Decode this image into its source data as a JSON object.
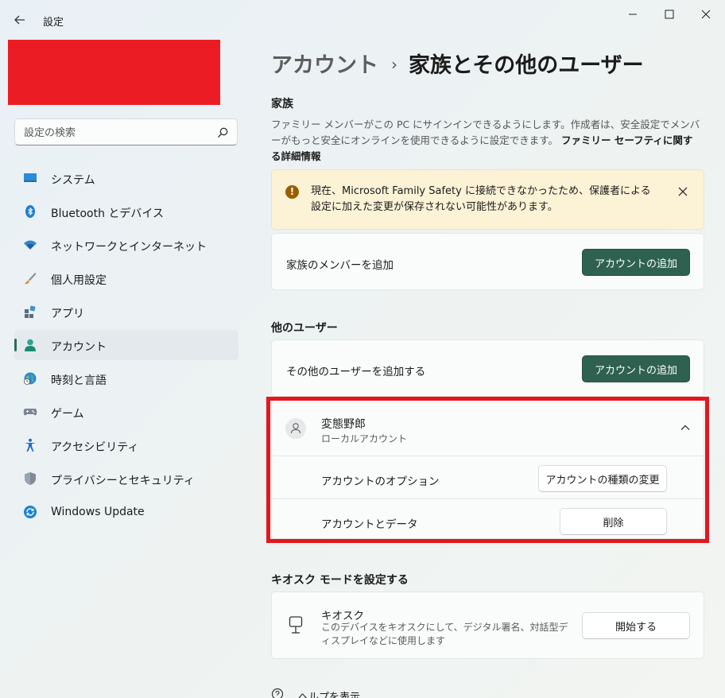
{
  "window": {
    "title": "設定"
  },
  "search": {
    "placeholder": "設定の検索"
  },
  "sidebar": {
    "items": [
      {
        "label": "システム",
        "icon": "system-icon"
      },
      {
        "label": "Bluetooth とデバイス",
        "icon": "bluetooth-icon"
      },
      {
        "label": "ネットワークとインターネット",
        "icon": "wifi-icon"
      },
      {
        "label": "個人用設定",
        "icon": "brush-icon"
      },
      {
        "label": "アプリ",
        "icon": "apps-icon"
      },
      {
        "label": "アカウント",
        "icon": "account-icon",
        "selected": true
      },
      {
        "label": "時刻と言語",
        "icon": "time-language-icon"
      },
      {
        "label": "ゲーム",
        "icon": "gamepad-icon"
      },
      {
        "label": "アクセシビリティ",
        "icon": "accessibility-icon"
      },
      {
        "label": "プライバシーとセキュリティ",
        "icon": "shield-icon"
      },
      {
        "label": "Windows Update",
        "icon": "update-icon"
      }
    ]
  },
  "breadcrumb": {
    "parent": "アカウント",
    "separator": "›",
    "current": "家族とその他のユーザー"
  },
  "family": {
    "heading": "家族",
    "description": "ファミリー メンバーがこの PC にサインインできるようにします。作成者は、安全設定でメンバーがもっと安全にオンラインを使用できるように設定できます。",
    "link": "ファミリー セーフティに関する詳細情報",
    "warning": "現在、Microsoft Family Safety に接続できなかったため、保護者による設定に加えた変更が保存されない可能性があります。",
    "add_label": "家族のメンバーを追加",
    "add_button": "アカウントの追加"
  },
  "other_users": {
    "heading": "他のユーザー",
    "add_label": "その他のユーザーを追加する",
    "add_button": "アカウントの追加",
    "user": {
      "name": "変態野郎",
      "type": "ローカルアカウント",
      "options_label": "アカウントのオプション",
      "options_button": "アカウントの種類の変更",
      "data_label": "アカウントとデータ",
      "data_button": "削除"
    }
  },
  "kiosk": {
    "heading": "キオスク モードを設定する",
    "title": "キオスク",
    "description": "このデバイスをキオスクにして、デジタル署名、対話型ディスプレイなどに使用します",
    "button": "開始する"
  },
  "help": {
    "label": "ヘルプを表示"
  },
  "colors": {
    "accent": "#2f6150",
    "highlight": "#e4161e",
    "redaction": "#ec1c24",
    "warning_bg": "#fcf3d6"
  }
}
